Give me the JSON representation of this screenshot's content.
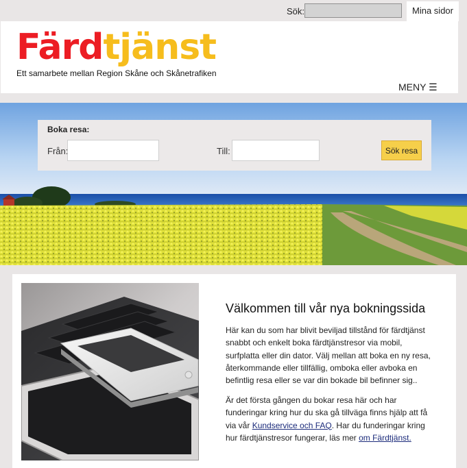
{
  "topbar": {
    "search_label": "Sök:",
    "search_value": "",
    "mina_sidor": "Mina sidor"
  },
  "header": {
    "logo_part1": "Färd",
    "logo_part2": "tjänst",
    "tagline": "Ett samarbete mellan Region Skåne och Skånetrafiken",
    "menu_label": "MENY ☰"
  },
  "booking": {
    "title": "Boka resa:",
    "from_label": "Från:",
    "from_value": "",
    "to_label": "Till:",
    "to_value": "",
    "search_button": "Sök resa"
  },
  "content": {
    "heading": "Välkommen till vår nya bokningssida",
    "paragraph1": "Här kan du som har blivit beviljad tillstånd för färdtjänst snabbt och enkelt boka färdtjänstresor via mobil, surfplatta eller din dator. Välj mellan att boka en ny resa, återkommande eller tillfällig, omboka eller avboka en befintlig resa eller se var din bokade bil befinner sig..",
    "paragraph2_before_link1": "Är det första gången du bokar resa här och har funderingar kring hur du ska gå tillväga finns hjälp att få via vår ",
    "link1": "Kundservice och FAQ",
    "paragraph2_between": ". Har du funderingar kring hur färdtjänstresor fungerar, läs mer ",
    "link2": "om Färdtjänst."
  },
  "colors": {
    "logo_red": "#ec1d24",
    "logo_yellow": "#f6bd1d",
    "button_yellow": "#f6cf4a",
    "page_bg": "#e9e6e6"
  }
}
